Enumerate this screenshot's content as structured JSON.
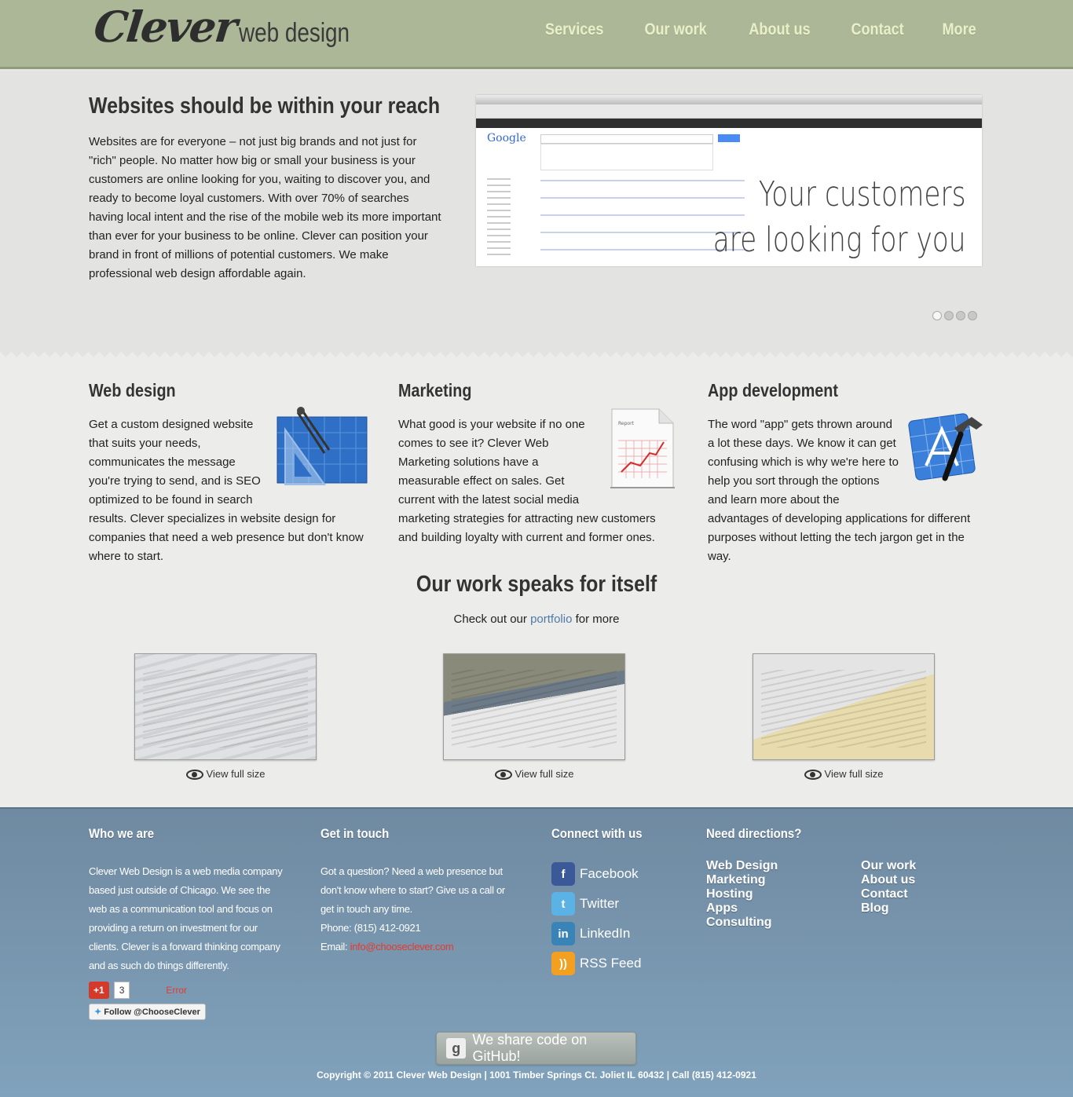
{
  "brand": {
    "logo_main": "Clever",
    "logo_sub": "web design"
  },
  "nav": [
    {
      "label": "Services"
    },
    {
      "label": "Our work"
    },
    {
      "label": "About us"
    },
    {
      "label": "Contact"
    },
    {
      "label": "More"
    }
  ],
  "hero": {
    "title": "Websites should be within your reach",
    "body": "Websites are for everyone – not just big brands and not just for \"rich\" people. No matter how big or small your business is your customers are online looking for you, waiting to discover you, and ready to become loyal customers. With over 70% of searches having local intent and the rise of the mobile web its more important than ever for your business to be online. Clever can position your brand in front of millions of potential customers. We make professional web design affordable again.",
    "slide_line1": "Your customers",
    "slide_line2": "are looking for you",
    "slide_google": "Google",
    "slide_count": 4,
    "slide_active": 1
  },
  "services": [
    {
      "title": "Web design",
      "body": "Get a custom designed website that suits your needs, communicates the message you're trying to send, and is SEO optimized to be found in search results. Clever specializes in website design for companies that need a web presence but don't know where to start.",
      "icon": "blueprint-icon"
    },
    {
      "title": "Marketing",
      "body": "What good is your website if no one comes to see it? Clever Web Marketing solutions have a measurable effect on sales. Get current with the latest social media marketing strategies for attracting new customers and building loyalty with current and former ones.",
      "icon": "report-icon",
      "icon_text": "Report"
    },
    {
      "title": "App development",
      "body": "The word \"app\" gets thrown around a lot these days. We know it can get confusing which is why we're here to help you sort through the options and learn more about the advantages of developing applications for different purposes without letting the tech jargon get in the way.",
      "icon": "hammer-icon"
    }
  ],
  "work": {
    "title": "Our work speaks for itself",
    "sub_before": "Check out our",
    "sub_link": "portfolio",
    "sub_after": "for more",
    "view_label": "View full size"
  },
  "footer": {
    "who_title": "Who we are",
    "who_body": "Clever Web Design is a web media company based just outside of Chicago. We see the web as a communication tool and focus on providing a return on investment for our clients. Clever is a forward thinking company and as such do things differently.",
    "gplus_label": "+1",
    "gplus_count": "3",
    "error_label": "Error",
    "follow_label": "Follow @ChooseClever",
    "touch_title": "Get in touch",
    "touch_body": "Got a question? Need a web presence but don't know where to start? Give us a call or get in touch any time.",
    "phone_label": "Phone:",
    "phone": "(815) 412-0921",
    "email_label": "Email:",
    "email": "info@chooseclever.com",
    "connect_title": "Connect with us",
    "social": [
      {
        "label": "Facebook",
        "icon": "facebook-icon",
        "glyph": "f"
      },
      {
        "label": "Twitter",
        "icon": "twitter-icon",
        "glyph": "t"
      },
      {
        "label": "LinkedIn",
        "icon": "linkedin-icon",
        "glyph": "in"
      },
      {
        "label": "RSS Feed",
        "icon": "rss-icon",
        "glyph": "))"
      }
    ],
    "directions_title": "Need directions?",
    "directions_a": [
      "Web Design",
      "Marketing",
      "Hosting",
      "Apps",
      "Consulting"
    ],
    "directions_b": [
      "Our work",
      "About us",
      "Contact",
      "Blog"
    ],
    "github_label": "We share code on GitHub!",
    "github_glyph": "g",
    "copyright": "Copyright © 2011 Clever Web Design | 1001 Timber Springs Ct. Joliet IL 60432 | Call (815) 412-0921"
  },
  "colors": {
    "header": "#abb796",
    "nav_text": "#e9f0c8",
    "footer": "#7590a8",
    "link": "#4f7aa8",
    "email": "#e63a2e"
  }
}
